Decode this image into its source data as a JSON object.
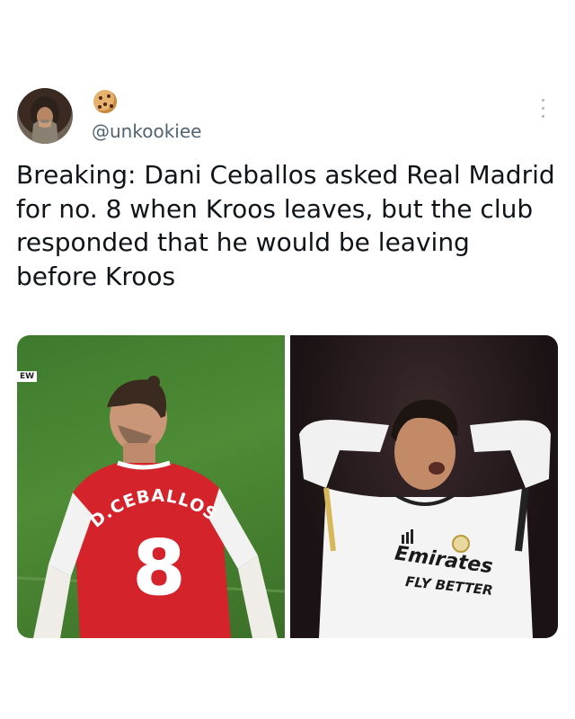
{
  "post": {
    "handle": "@unkookiee",
    "text": "Breaking: Dani Ceballos asked Real Madrid for no. 8 when Kroos leaves, but the club responded that he would be leaving before Kroos"
  },
  "media": {
    "left": {
      "tv_tag": "EW",
      "shirt_name": "D.CEBALLOS",
      "shirt_number": "8"
    },
    "right": {
      "sponsor_line1": "Emirates",
      "sponsor_line2": "FLY BETTER"
    }
  },
  "colors": {
    "handle": "#536471",
    "text": "#0f1419",
    "arsenal_red": "#d4232b",
    "madrid_white": "#f4f4f4"
  }
}
